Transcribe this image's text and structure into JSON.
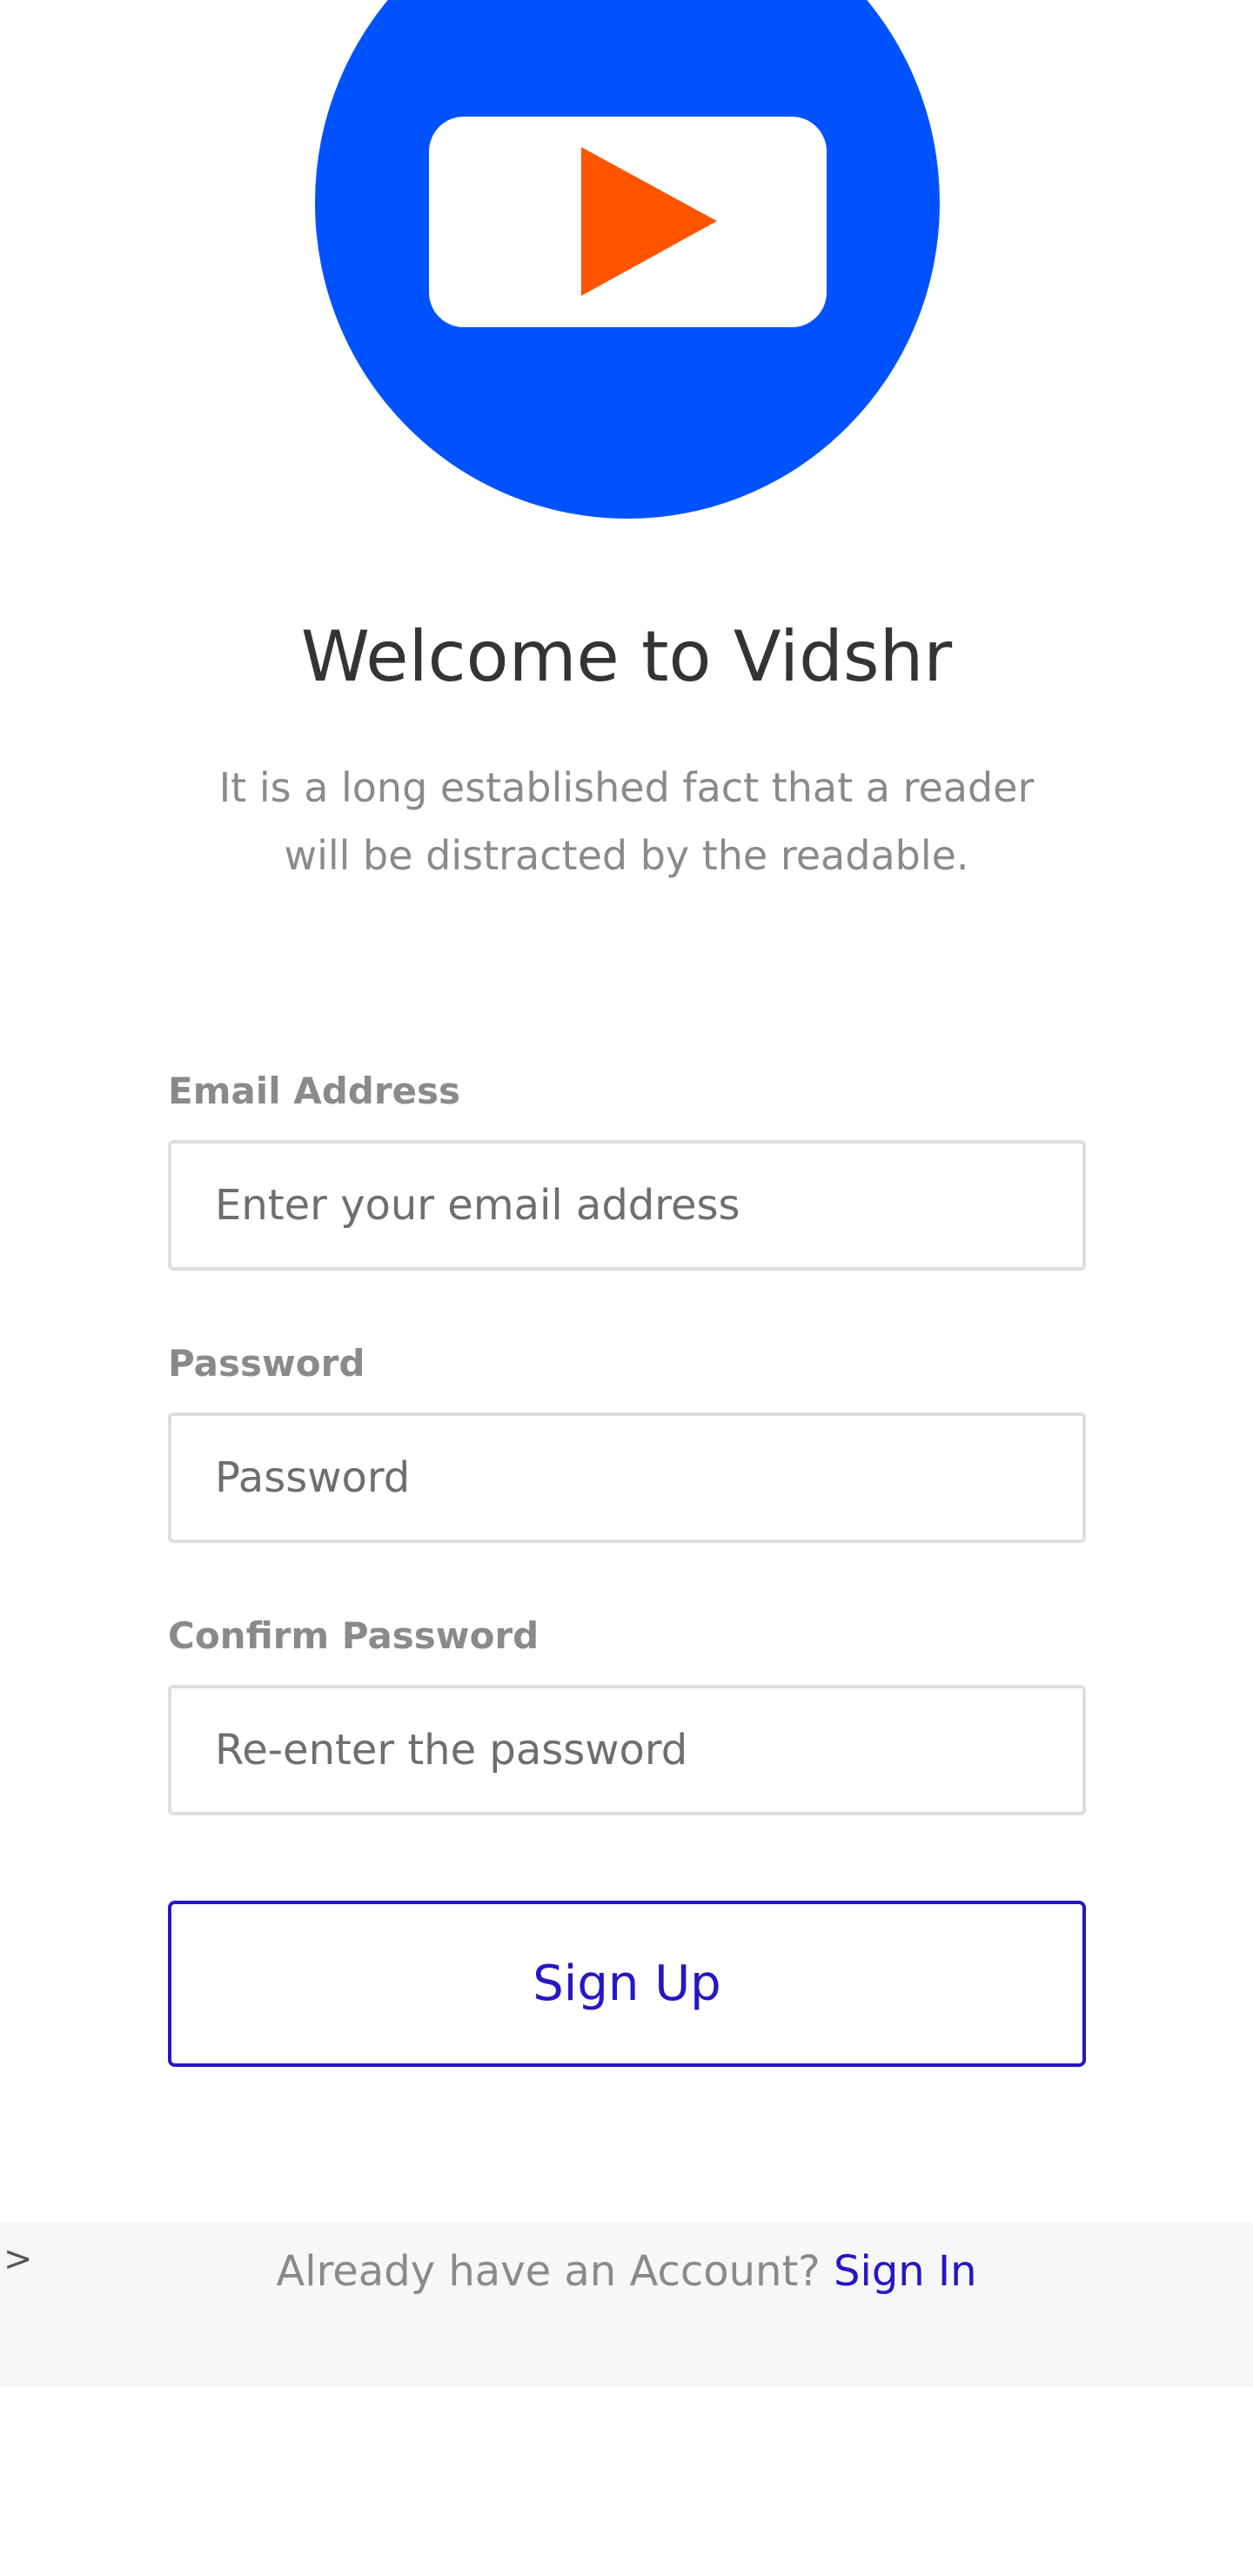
{
  "logo": {
    "icon": "play-icon",
    "colors": {
      "circle": "#0052ff",
      "screen": "#ffffff",
      "play": "#ff5400"
    }
  },
  "welcome": {
    "title": "Welcome to Vidshr",
    "subtitle_line1": "It is a long established fact that a reader",
    "subtitle_line2": "will be distracted by the readable."
  },
  "form": {
    "email": {
      "label": "Email Address",
      "placeholder": "Enter your email address",
      "value": ""
    },
    "password": {
      "label": "Password",
      "placeholder": "Password",
      "value": ""
    },
    "confirm_password": {
      "label": "Confirm Password",
      "placeholder": "Re-enter the password",
      "value": ""
    },
    "submit_label": "Sign Up"
  },
  "footer": {
    "caret": ">",
    "prompt": "Already have an Account?",
    "link_label": "Sign In"
  },
  "colors": {
    "accent": "#2616c6",
    "muted_text": "#8a8a8a",
    "input_border": "#dedede",
    "footer_bg": "#f7f7f7"
  }
}
